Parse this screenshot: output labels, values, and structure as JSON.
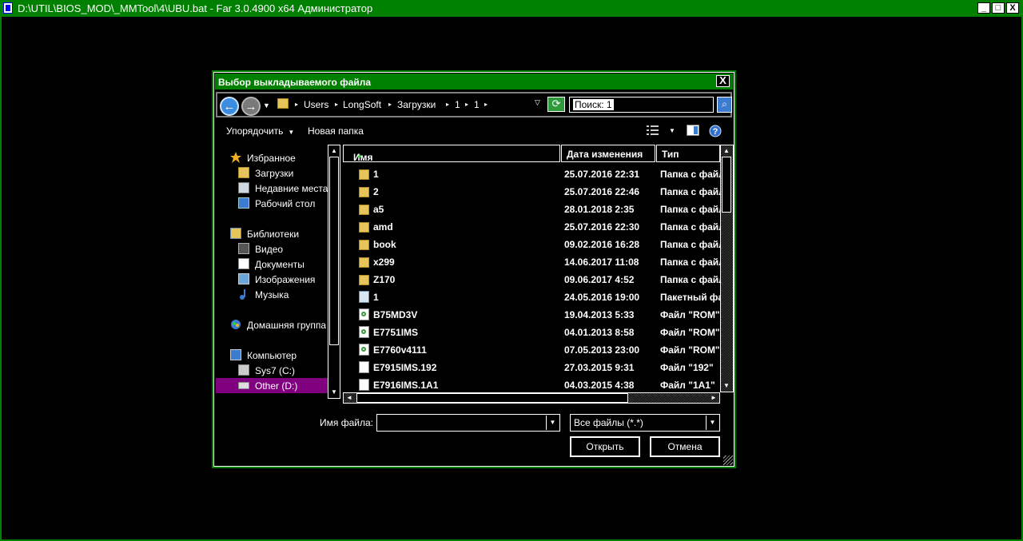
{
  "window": {
    "title": "D:\\UTIL\\BIOS_MOD\\_MMTool\\4\\UBU.bat - Far 3.0.4900 x64 Администратор",
    "min_label": "_",
    "max_label": "□",
    "close_label": "X"
  },
  "dialog": {
    "title": "Выбор выкладываемого файла",
    "close_label": "X",
    "nav": {
      "back_glyph": "←",
      "fwd_glyph": "→",
      "drop_glyph": "▼"
    },
    "breadcrumbs": [
      "Users",
      "LongSoft",
      "Загрузки",
      "1",
      "1"
    ],
    "crumb_sep": "▸",
    "crumb_dropdown": "▽",
    "refresh_glyph": "⟳",
    "search": {
      "value": "Поиск: 1",
      "button_glyph": "⌕"
    },
    "toolbar": {
      "organize": "Упорядочить",
      "new_folder": "Новая папка",
      "caret": "▼",
      "help": "?"
    },
    "nav_pane": {
      "items": [
        {
          "label": "Избранное",
          "icon": "star-icon",
          "level": 0
        },
        {
          "label": "Загрузки",
          "icon": "downloads-icon",
          "level": 1
        },
        {
          "label": "Недавние места",
          "icon": "recent-places-icon",
          "level": 1
        },
        {
          "label": "Рабочий стол",
          "icon": "desktop-icon",
          "level": 1
        },
        {
          "label": "Библиотеки",
          "icon": "libraries-icon",
          "level": 0
        },
        {
          "label": "Видео",
          "icon": "video-icon",
          "level": 1
        },
        {
          "label": "Документы",
          "icon": "documents-icon",
          "level": 1
        },
        {
          "label": "Изображения",
          "icon": "pictures-icon",
          "level": 1
        },
        {
          "label": "Музыка",
          "icon": "music-icon",
          "level": 1
        },
        {
          "label": "Домашняя группа",
          "icon": "homegroup-icon",
          "level": 0
        },
        {
          "label": "Компьютер",
          "icon": "computer-icon",
          "level": 0
        },
        {
          "label": "Sys7 (C:)",
          "icon": "system-drive-icon",
          "level": 1
        },
        {
          "label": "Other (D:)",
          "icon": "drive-icon",
          "level": 1,
          "selected": true
        }
      ]
    },
    "columns": {
      "name": "Имя",
      "sort_indicator": "▲",
      "date": "Дата изменения",
      "type": "Тип"
    },
    "files": [
      {
        "name": "1",
        "date": "25.07.2016 22:31",
        "type": "Папка с файлами",
        "icon": "folder"
      },
      {
        "name": "2",
        "date": "25.07.2016 22:46",
        "type": "Папка с файлами",
        "icon": "folder"
      },
      {
        "name": "a5",
        "date": "28.01.2018 2:35",
        "type": "Папка с файлами",
        "icon": "folder"
      },
      {
        "name": "amd",
        "date": "25.07.2016 22:30",
        "type": "Папка с файлами",
        "icon": "folder"
      },
      {
        "name": "book",
        "date": "09.02.2016 16:28",
        "type": "Папка с файлами",
        "icon": "folder"
      },
      {
        "name": "x299",
        "date": "14.06.2017 11:08",
        "type": "Папка с файлами",
        "icon": "folder"
      },
      {
        "name": "Z170",
        "date": "09.06.2017 4:52",
        "type": "Папка с файлами",
        "icon": "folder"
      },
      {
        "name": "1",
        "date": "24.05.2016 19:00",
        "type": "Пакетный файл",
        "icon": "bat"
      },
      {
        "name": "B75MD3V",
        "date": "19.04.2013 5:33",
        "type": "Файл \"ROM\"",
        "icon": "rom"
      },
      {
        "name": "E7751IMS",
        "date": "04.01.2013 8:58",
        "type": "Файл \"ROM\"",
        "icon": "rom"
      },
      {
        "name": "E7760v4111",
        "date": "07.05.2013 23:00",
        "type": "Файл \"ROM\"",
        "icon": "rom"
      },
      {
        "name": "E7915IMS.192",
        "date": "27.03.2015 9:31",
        "type": "Файл \"192\"",
        "icon": "file"
      },
      {
        "name": "E7916IMS.1A1",
        "date": "04.03.2015 4:38",
        "type": "Файл \"1A1\"",
        "icon": "file"
      }
    ],
    "filename_label": "Имя файла:",
    "filename_value": "",
    "filter_value": "Все файлы (*.*)",
    "combo_caret": "▼",
    "open_label": "Открыть",
    "cancel_label": "Отмена",
    "scroll": {
      "up": "▲",
      "down": "▼",
      "left": "◄",
      "right": "►"
    }
  },
  "colors": {
    "accent": "#008000",
    "selection": "#800080",
    "background": "#000000"
  }
}
